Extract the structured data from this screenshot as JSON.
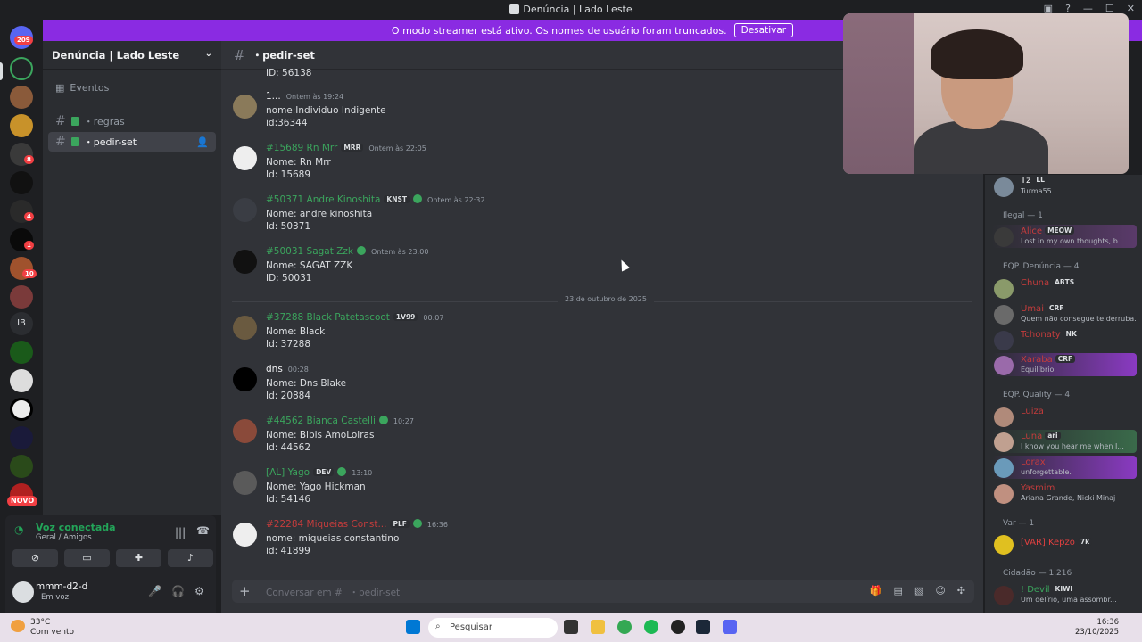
{
  "window": {
    "title": "Denúncia | Lado Leste"
  },
  "banner": {
    "text": "O modo streamer está ativo. Os nomes de usuário foram truncados.",
    "button": "Desativar"
  },
  "rail": {
    "badge_top": "209",
    "badges": [
      "8",
      "4",
      "1",
      "10"
    ],
    "ib_label": "IB",
    "novo": "NOVO"
  },
  "server": {
    "name": "Denúncia | Lado Leste"
  },
  "sidebar": {
    "events": "Eventos",
    "channels": [
      {
        "name": "・regras"
      },
      {
        "name": "・pedir-set"
      }
    ]
  },
  "voice": {
    "status": "Voz conectada",
    "channel": "Geral / Amigos"
  },
  "user": {
    "name": "mmm-d2-d",
    "status": "Em voz"
  },
  "channel": {
    "name": "・pedir-set",
    "placeholder": "Conversar em #⠀・pedir-set"
  },
  "messages": [
    {
      "name": "1...",
      "tag": "",
      "time": "Ontem às 19:24",
      "line1": "nome:Individuo Indigente",
      "line2": "id:36344",
      "color": "#dbdee1"
    },
    {
      "name": "#15689 Rn Mrr",
      "tag": "MRR",
      "time": "Ontem às 22:05",
      "line1": "Nome: Rn Mrr",
      "line2": "Id: 15689",
      "color": "#3ba55d"
    },
    {
      "name": "#50371 Andre Kinoshita",
      "tag": "KNST",
      "time": "Ontem às 22:32",
      "line1": "Nome: andre kinoshita",
      "line2": "Id: 50371",
      "color": "#3ba55d"
    },
    {
      "name": "#50031 Sagat Zzk",
      "tag": "",
      "time": "Ontem às 23:00",
      "line1": "Nome: SAGAT ZZK",
      "line2": "ID: 50031",
      "color": "#3ba55d"
    },
    {
      "name": "#37288 Black Patetascoot",
      "tag": "1V99",
      "time": "00:07",
      "line1": "Nome: Black",
      "line2": "Id: 37288",
      "color": "#3ba55d"
    },
    {
      "name": "dns",
      "tag": "",
      "time": "00:28",
      "line1": "Nome: Dns Blake",
      "line2": "Id: 20884",
      "color": "#f2f3f5"
    },
    {
      "name": "#44562 Bianca Castelli",
      "tag": "",
      "time": "10:27",
      "line1": "Nome: Bibis AmoLoiras",
      "line2": "Id: 44562",
      "color": "#3ba55d"
    },
    {
      "name": "[AL] Yago",
      "tag": "DEV",
      "time": "13:10",
      "line1": "Nome: Yago Hickman",
      "line2": "Id: 54146",
      "color": "#3ba55d"
    },
    {
      "name": "#22284 Miqueias Const...",
      "tag": "PLF",
      "time": "16:36",
      "line1": "nome: miqueias constantino",
      "line2": "id: 41899",
      "color": "#c43c3c"
    }
  ],
  "date_divider": "23 de outubro de 2025",
  "partial_top": "ID: 56138",
  "members": {
    "top": {
      "name": "Tz",
      "tag": "LL",
      "status": "Turma55"
    },
    "groups": [
      {
        "label": "Ilegal — 1"
      },
      {
        "label": "EQP. Denúncia — 4"
      },
      {
        "label": "EQP. Quality — 4"
      },
      {
        "label": "Var — 1"
      },
      {
        "label": "Cidadão — 1.216"
      }
    ],
    "list": [
      {
        "name": "Alice",
        "tag": "MEOW",
        "status": "Lost in my own thoughts, b..."
      },
      {
        "name": "Chuna",
        "tag": "ABTS",
        "status": ""
      },
      {
        "name": "Umai",
        "tag": "CRF",
        "status": "Quem não consegue te derruba..."
      },
      {
        "name": "Tchonaty",
        "tag": "NK",
        "status": ""
      },
      {
        "name": "Xaraba",
        "tag": "CRF",
        "status": "Equilíbrio"
      },
      {
        "name": "Luiza",
        "tag": "",
        "status": ""
      },
      {
        "name": "Luna",
        "tag": "ari",
        "status": "I know you hear me when I..."
      },
      {
        "name": "Lorax",
        "tag": "",
        "status": "unforgettable."
      },
      {
        "name": "Yasmim",
        "tag": "",
        "status": "Ariana Grande, Nicki Minaj"
      },
      {
        "name": "[VAR] Kepzo",
        "tag": "7k",
        "status": ""
      },
      {
        "name": "! Devil",
        "tag": "KIWI",
        "status": "Um delírio, uma assombr..."
      }
    ]
  },
  "taskbar": {
    "temp": "33°C",
    "weather": "Com vento",
    "search": "Pesquisar",
    "time": "16:36",
    "date": "23/10/2025"
  }
}
